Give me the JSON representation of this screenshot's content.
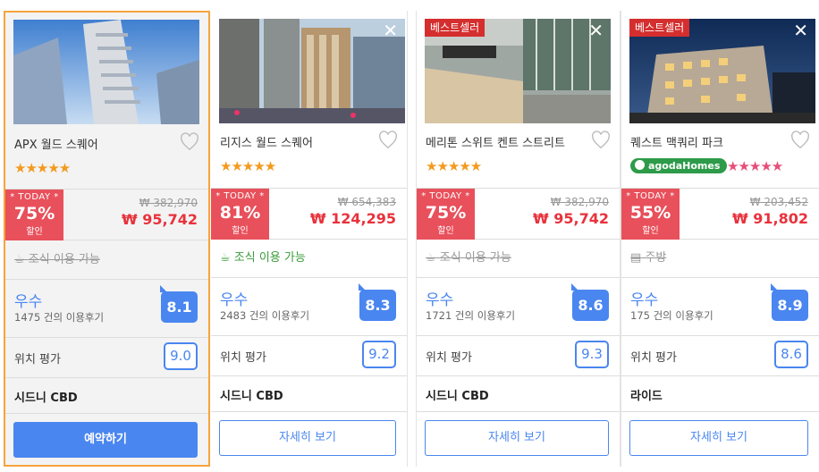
{
  "hotels": [
    {
      "name": "APX 월드 스퀘어",
      "stars": "★★★★★",
      "badge": "",
      "today_label": "* TODAY *",
      "discount_pct": "75%",
      "discount_word": "할인",
      "old_price": "₩ 382,970",
      "new_price": "₩ 95,742",
      "amenity": "조식 이용 가능",
      "amenity_available": false,
      "review_word": "우수",
      "review_count": "1475 건의 이용후기",
      "score": "8.1",
      "location_label": "위치 평가",
      "location_score": "9.0",
      "area": "시드니 CBD",
      "button": "예약하기"
    },
    {
      "name": "리지스 월드 스퀘어",
      "stars": "★★★★★",
      "badge": "",
      "today_label": "* TODAY *",
      "discount_pct": "81%",
      "discount_word": "할인",
      "old_price": "₩ 654,383",
      "new_price": "₩ 124,295",
      "amenity": "조식 이용 가능",
      "amenity_available": true,
      "review_word": "우수",
      "review_count": "2483 건의 이용후기",
      "score": "8.3",
      "location_label": "위치 평가",
      "location_score": "9.2",
      "area": "시드니 CBD",
      "button": "자세히 보기"
    },
    {
      "name": "메리톤 스위트 켄트 스트리트",
      "stars": "★★★★★",
      "badge": "베스트셀러",
      "today_label": "* TODAY *",
      "discount_pct": "75%",
      "discount_word": "할인",
      "old_price": "₩ 382,970",
      "new_price": "₩ 95,742",
      "amenity": "조식 이용 가능",
      "amenity_available": false,
      "review_word": "우수",
      "review_count": "1721 건의 이용후기",
      "score": "8.6",
      "location_label": "위치 평가",
      "location_score": "9.3",
      "area": "시드니 CBD",
      "button": "자세히 보기"
    },
    {
      "name": "퀘스트 맥쿼리 파크",
      "stars": "★★★★★",
      "badge": "베스트셀러",
      "agoda_label": "agodaHomes",
      "today_label": "* TODAY *",
      "discount_pct": "55%",
      "discount_word": "할인",
      "old_price": "₩ 203,452",
      "new_price": "₩ 91,802",
      "amenity": "주방",
      "amenity_available": false,
      "review_word": "우수",
      "review_count": "175 건의 이용후기",
      "score": "8.9",
      "location_label": "위치 평가",
      "location_score": "8.6",
      "area": "라이드",
      "button": "자세히 보기"
    }
  ],
  "colors": {
    "accent": "#4a86f0",
    "discount_red": "#e8505b",
    "price_red": "#e8323c",
    "selected_border": "#f6a33c",
    "star_orange": "#f39a1e",
    "star_pink": "#e64e78",
    "agoda_green": "#2e9b4a",
    "bestseller_red": "#d42e2e"
  },
  "close_symbol": "✕"
}
